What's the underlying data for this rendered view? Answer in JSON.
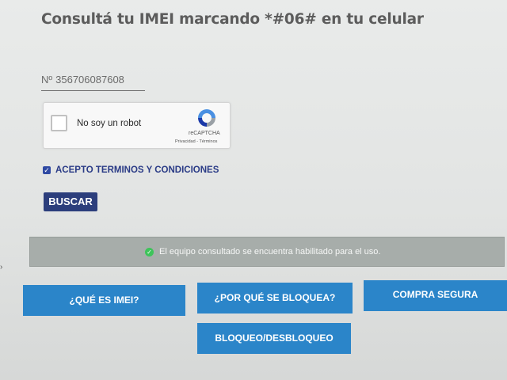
{
  "header": {
    "title": "Consultá tu IMEI marcando *#06# en tu celular"
  },
  "imei": {
    "prefix": "Nº",
    "value": "356706087608"
  },
  "recaptcha": {
    "label": "No soy un robot",
    "brand": "reCAPTCHA",
    "links": "Privacidad - Términos",
    "checked": false
  },
  "terms": {
    "label": "ACEPTO TERMINOS Y CONDICIONES",
    "checked": true
  },
  "search": {
    "button_label": "BUSCAR"
  },
  "status": {
    "message": "El equipo consultado se encuentra habilitado para el uso.",
    "color": "#3ec45a"
  },
  "nav": {
    "what_is_imei": "¿QUÉ ES IMEI?",
    "why_blocked": "¿POR QUÉ SE BLOQUEA?",
    "safe_purchase": "COMPRA SEGURA",
    "block_unblock": "BLOQUEO/DESBLOQUEO"
  },
  "colors": {
    "nav_button": "#2b85c9",
    "search_button": "#2c3e7c",
    "terms_text": "#2a3b86",
    "status_bar": "#a7adaa"
  }
}
